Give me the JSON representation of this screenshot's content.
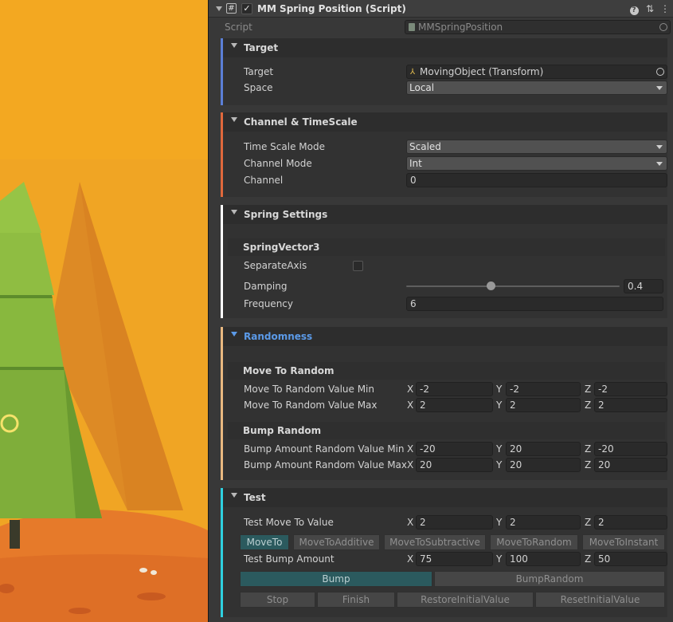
{
  "component": {
    "title": "MM Spring Position (Script)",
    "script_label": "Script",
    "script_value": "MMSpringPosition"
  },
  "groups": {
    "target": {
      "title": "Target",
      "accent": "#5b7fd6",
      "target_label": "Target",
      "target_value": "MovingObject (Transform)",
      "space_label": "Space",
      "space_value": "Local"
    },
    "channel": {
      "title": "Channel & TimeScale",
      "accent": "#e0683c",
      "time_scale_label": "Time Scale Mode",
      "time_scale_value": "Scaled",
      "channel_mode_label": "Channel Mode",
      "channel_mode_value": "Int",
      "channel_label": "Channel",
      "channel_value": "0"
    },
    "spring": {
      "title": "Spring Settings",
      "accent": "#ffffff",
      "sub_title": "SpringVector3",
      "separate_axis_label": "SeparateAxis",
      "separate_axis_checked": false,
      "damping_label": "Damping",
      "damping_value": "0.4",
      "frequency_label": "Frequency",
      "frequency_value": "6"
    },
    "randomness": {
      "title": "Randomness",
      "accent": "#e8b880",
      "move_to_random_title": "Move To Random",
      "min_label": "Move To Random Value Min",
      "min": {
        "x": "-2",
        "y": "-2",
        "z": "-2"
      },
      "max_label": "Move To Random Value Max",
      "max": {
        "x": "2",
        "y": "2",
        "z": "2"
      },
      "bump_random_title": "Bump Random",
      "bump_min_label": "Bump Amount Random Value Min",
      "bump_min": {
        "x": "-20",
        "y": "20",
        "z": "-20"
      },
      "bump_max_label": "Bump Amount Random Value Max",
      "bump_max": {
        "x": "20",
        "y": "20",
        "z": "20"
      }
    },
    "test": {
      "title": "Test",
      "accent": "#2fd0e0",
      "move_value_label": "Test Move To Value",
      "move_value": {
        "x": "2",
        "y": "2",
        "z": "2"
      },
      "move_buttons": [
        "MoveTo",
        "MoveToAdditive",
        "MoveToSubtractive",
        "MoveToRandom",
        "MoveToInstant"
      ],
      "bump_amount_label": "Test Bump Amount",
      "bump_amount": {
        "x": "75",
        "y": "100",
        "z": "50"
      },
      "bump_buttons": [
        "Bump",
        "BumpRandom"
      ],
      "control_buttons": [
        "Stop",
        "Finish",
        "RestoreInitialValue",
        "ResetInitialValue"
      ]
    }
  },
  "axis_labels": {
    "x": "X",
    "y": "Y",
    "z": "Z"
  }
}
